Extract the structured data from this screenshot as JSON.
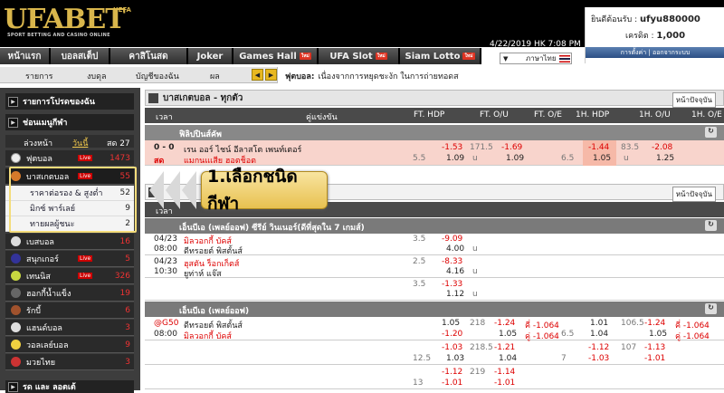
{
  "logo": {
    "brand": "UFABET",
    "super": "UEFA",
    "tagline": "SPORT BETTING AND CASINO ONLINE"
  },
  "nav": {
    "tabs": [
      {
        "label": "หน้าแรก",
        "badge": ""
      },
      {
        "label": "บอลสเต็ป",
        "badge": ""
      },
      {
        "label": "คาสิโนสด",
        "badge": ""
      },
      {
        "label": "Joker",
        "badge": ""
      },
      {
        "label": "Games Hall",
        "badge": "ใหม่"
      },
      {
        "label": "UFA Slot",
        "badge": "ใหม่"
      },
      {
        "label": "Siam Lotto",
        "badge": "ใหม่"
      }
    ]
  },
  "header": {
    "datetime": "4/22/2019 HK 7:08 PM",
    "language": "ภาษาไทย"
  },
  "user": {
    "welcome_label": "ยินดีต้อนรับ :",
    "username": "ufyu880000",
    "credit_label": "เครดิต :",
    "credit": "1,000",
    "settings": "การตั้งค่า",
    "logout": "ออกจากระบบ",
    "sep": "|"
  },
  "subnav": {
    "items": [
      "รายการ",
      "งบดุล",
      "บัญชีของฉัน",
      "ผล"
    ],
    "marquee_label": "ฟุตบอล:",
    "marquee_text": "เนื่องจากการหยุดชะงัก ในการถ่ายทอดส"
  },
  "sidebar": {
    "favorites": "รายการโปรดของฉัน",
    "sports_menu": "ช่อนเมนูกีฬา",
    "day_tabs": [
      "ล่วงหน้า",
      "วันนี้",
      "สด 27"
    ],
    "sports": [
      {
        "name": "ฟุตบอล",
        "live": "Live",
        "count": "1473",
        "color": "#e8e8e8"
      },
      {
        "name": "บาสเกตบอล",
        "live": "Live",
        "count": "55",
        "color": "#d77a2a"
      },
      {
        "name": "เบสบอล",
        "live": "",
        "count": "16",
        "color": "#dddddd"
      },
      {
        "name": "สนุกเกอร์",
        "live": "Live",
        "count": "5",
        "color": "#333399"
      },
      {
        "name": "เทนนิส",
        "live": "Live",
        "count": "326",
        "color": "#c8d840"
      },
      {
        "name": "ฮอกกี้น้ำแข็ง",
        "live": "",
        "count": "19",
        "color": "#666666"
      },
      {
        "name": "รักบี้",
        "live": "",
        "count": "6",
        "color": "#a0522d"
      },
      {
        "name": "แฮนด์บอล",
        "live": "",
        "count": "3",
        "color": "#e0e0e0"
      },
      {
        "name": "วอลเลย์บอล",
        "live": "",
        "count": "9",
        "color": "#f0d040"
      },
      {
        "name": "มวยไทย",
        "live": "",
        "count": "3",
        "color": "#cc3333"
      }
    ],
    "submenu": [
      {
        "label": "ราคาต่อรอง & สูงต่ำ",
        "count": "52"
      },
      {
        "label": "มิกซ์ พาร์เลย์",
        "count": "9"
      },
      {
        "label": "ทายผลผู้ชนะ",
        "count": "2"
      }
    ],
    "tooltip": "1.เลือกชนิดกีฬา",
    "footer": "รด และ ลอตเต้"
  },
  "main": {
    "section1_title": "บาสเกตบอล - ทุกตัว",
    "section2_title": "",
    "now_button": "หน้าปัจจุบัน",
    "columns": {
      "time": "เวลา",
      "match": "คู่แข่งขัน",
      "ft_hdp": "FT. HDP",
      "ft_ou": "FT. O/U",
      "ft_oe": "FT. O/E",
      "h1_hdp": "1H. HDP",
      "h1_ou": "1H. O/U",
      "h1_oe": "1H. O/E"
    },
    "league1": "ฟิลิปปินส์คัพ",
    "live_match": {
      "score": "0 - 0",
      "status": "สด",
      "home": "เรน ออร์ ไชน์ อีลาสโต เพนท์เตอร์",
      "away": "แมกนแเสีย ฮอตช็อต",
      "ft_hdp": "5.5",
      "ft_hdp_h": "-1.53",
      "ft_hdp_a": "1.09",
      "ft_ou": "171.5",
      "ft_ou_u": "u",
      "ft_ou_h": "-1.69",
      "ft_ou_a": "1.09",
      "h1_hdp": "6.5",
      "h1_hdp_h": "-1.44",
      "h1_hdp_a": "1.05",
      "h1_ou": "83.5",
      "h1_ou_u": "u",
      "h1_ou_h": "-2.08",
      "h1_ou_a": "1.25"
    },
    "league2": "เอ็นบีเอ (เพลย์ออฟ) ซีรีย์ วินเนอร์(ดีที่สุดใน 7 เกมส์)",
    "outrights": [
      {
        "date": "04/23",
        "time": "08:00",
        "a": "มิลวอกกี้ บัคส์",
        "b": "ดีทรอยต์ พิสตั้นส์",
        "line": "3.5",
        "o1": "-9.09",
        "o2": "4.00",
        "u": "u"
      },
      {
        "date": "04/23",
        "time": "10:30",
        "a": "ฮุสตัน ร็อกเก็ตส์",
        "b": "ยูท่าห์ แจ๊ส",
        "line": "2.5",
        "o1": "-8.33",
        "o2": "4.16",
        "u": "u"
      },
      {
        "date": "",
        "time": "",
        "a": "",
        "b": "",
        "line": "3.5",
        "o1": "-1.33",
        "o2": "1.12",
        "u": "u"
      }
    ],
    "league3": "เอ็นบีเอ (เพลย์ออฟ)",
    "game": {
      "code": "@G50",
      "time": "08:00",
      "home": "ดีทรอยต์ พิสตั้นส์",
      "away": "มิลวอกกี้ บัคส์"
    },
    "lines": [
      {
        "hdp": "",
        "h": "1.05",
        "a": "-1.20",
        "ou": "218",
        "ou_h": "-1.24",
        "ou_a": "1.05",
        "oe_h": "คี่ -1.064",
        "oe_a": "คู่ -1.064",
        "h1": "6.5",
        "h1h": "1.01",
        "h1a": "1.04",
        "h1ou": "106.5",
        "h1ouh": "-1.24",
        "h1oua": "1.05",
        "h1oeh": "คี่ -1.064",
        "h1oea": "คู่ -1.064"
      },
      {
        "hdp": "12.5",
        "h": "-1.03",
        "a": "1.03",
        "ou": "218.5",
        "ou_h": "-1.21",
        "ou_a": "1.04",
        "oe_h": "",
        "oe_a": "",
        "h1": "7",
        "h1h": "-1.12",
        "h1a": "-1.03",
        "h1ou": "107",
        "h1ouh": "-1.13",
        "h1oua": "-1.01",
        "h1oeh": "",
        "h1oea": ""
      },
      {
        "hdp": "13",
        "h": "-1.12",
        "a": "-1.01",
        "ou": "219",
        "ou_h": "-1.14",
        "ou_a": "-1.01",
        "oe_h": "",
        "oe_a": "",
        "h1": "",
        "h1h": "",
        "h1a": "",
        "h1ou": "",
        "h1ouh": "",
        "h1oua": "",
        "h1oeh": "",
        "h1oea": ""
      }
    ]
  }
}
